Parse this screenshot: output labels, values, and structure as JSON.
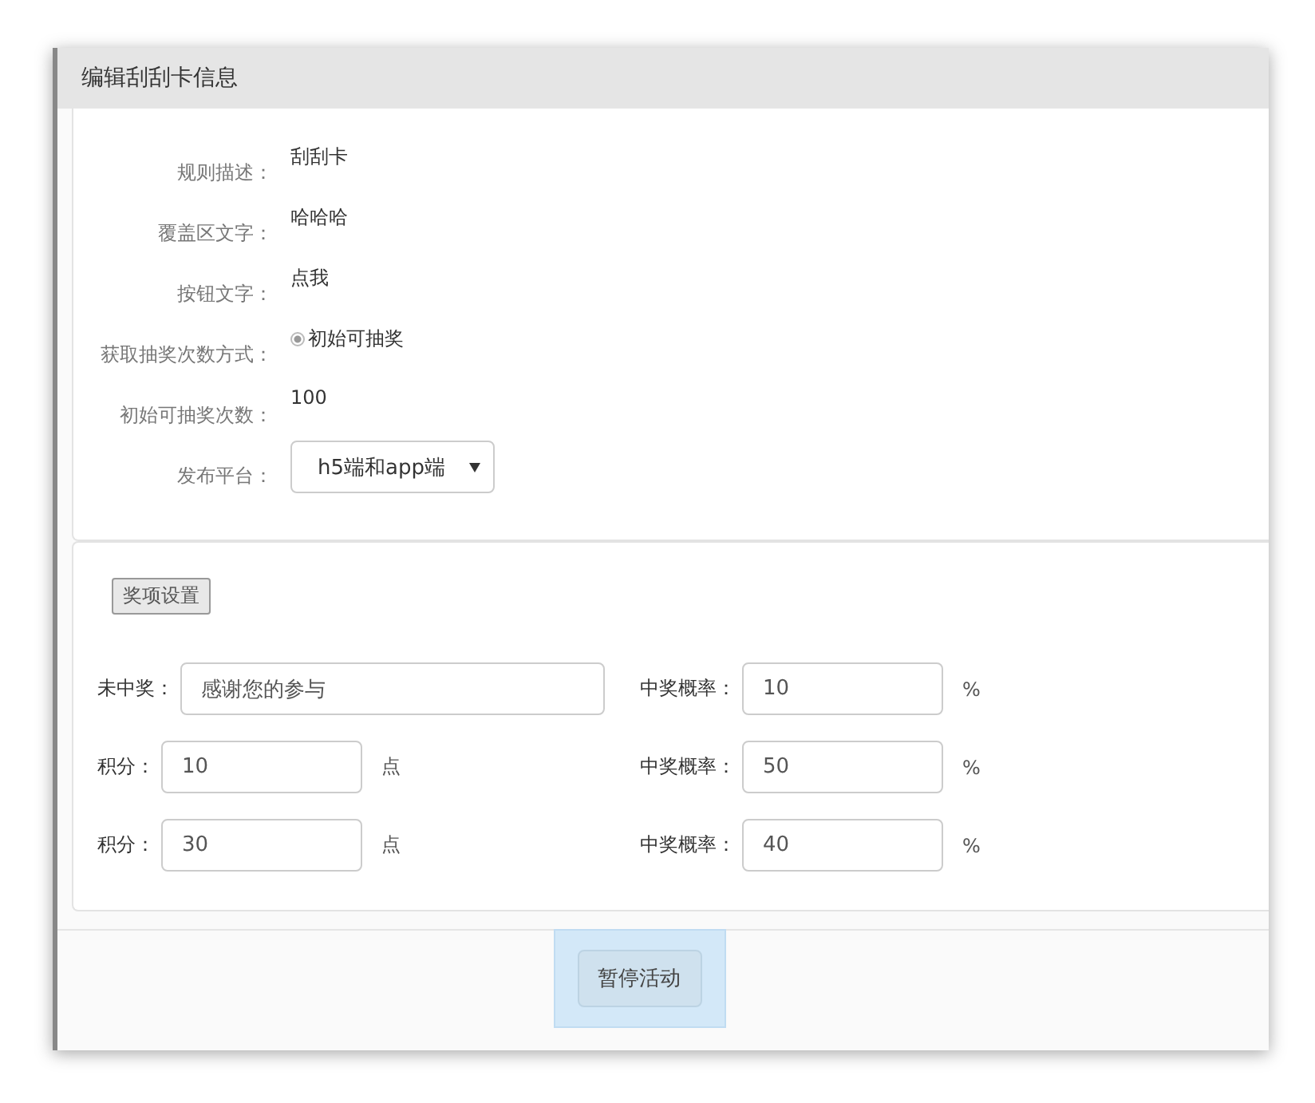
{
  "dialog": {
    "title": "编辑刮刮卡信息"
  },
  "fields": [
    {
      "kind": "text",
      "label": "规则描述：",
      "value": "刮刮卡"
    },
    {
      "kind": "text",
      "label": "覆盖区文字：",
      "value": "哈哈哈"
    },
    {
      "kind": "text",
      "label": "按钮文字：",
      "value": "点我"
    },
    {
      "kind": "radio",
      "label": "获取抽奖次数方式：",
      "value": "初始可抽奖",
      "checked": true
    },
    {
      "kind": "text",
      "label": "初始可抽奖次数：",
      "value": "100"
    },
    {
      "kind": "select",
      "label": "发布平台：",
      "value": "h5端和app端"
    }
  ],
  "prize_section": {
    "button": "奖项设置",
    "rows": [
      {
        "kind": "wide",
        "label": "未中奖：",
        "value": "感谢您的参与",
        "rate_label": "中奖概率：",
        "rate": "10",
        "rate_unit": "%"
      },
      {
        "kind": "narrow",
        "label": "积分：",
        "value": "10",
        "unit": "点",
        "rate_label": "中奖概率：",
        "rate": "50",
        "rate_unit": "%"
      },
      {
        "kind": "narrow",
        "label": "积分：",
        "value": "30",
        "unit": "点",
        "rate_label": "中奖概率：",
        "rate": "40",
        "rate_unit": "%"
      }
    ]
  },
  "footer": {
    "button": "暂停活动",
    "highlighted": true
  }
}
